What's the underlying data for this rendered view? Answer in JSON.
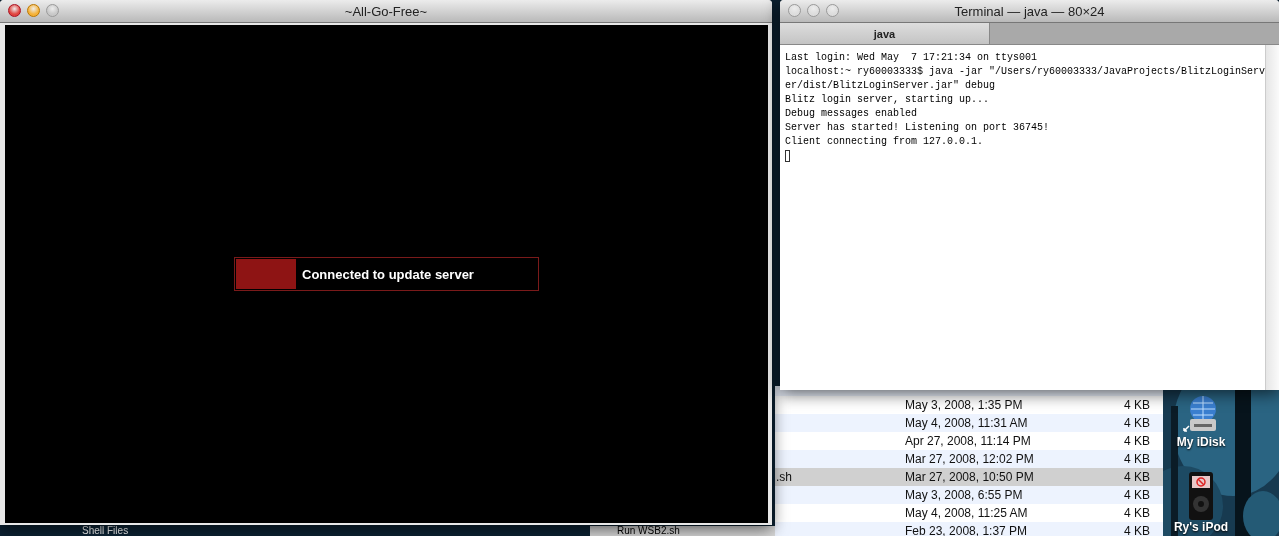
{
  "game_window": {
    "title": "~All-Go-Free~",
    "status": {
      "text": "Connected to update server",
      "level": 0.2
    }
  },
  "terminal": {
    "title": "Terminal — java — 80×24",
    "tabs": [
      {
        "label": "java",
        "selected": true
      }
    ],
    "lines": [
      "Last login: Wed May  7 17:21:34 on ttys001",
      "localhost:~ ry60003333$ java -jar \"/Users/ry60003333/JavaProjects/BlitzLoginServ",
      "er/dist/BlitzLoginServer.jar\" debug",
      "Blitz login server, starting up...",
      "Debug messages enabled",
      "Server has started! Listening on port 36745!",
      "Client connecting from 127.0.0.1."
    ],
    "cursor": true
  },
  "finder": {
    "rows": [
      {
        "date": "May 3, 2008, 1:35 PM",
        "size": "4 KB",
        "selected": false
      },
      {
        "date": "May 4, 2008, 11:31 AM",
        "size": "4 KB",
        "selected": false
      },
      {
        "date": "Apr 27, 2008, 11:14 PM",
        "size": "4 KB",
        "selected": false
      },
      {
        "date": "Mar 27, 2008, 12:02 PM",
        "size": "4 KB",
        "selected": false
      },
      {
        "name": ".sh",
        "date": "Mar 27, 2008, 10:50 PM",
        "size": "4 KB",
        "selected": true
      },
      {
        "date": "May 3, 2008, 6:55 PM",
        "size": "4 KB",
        "selected": false
      },
      {
        "date": "May 4, 2008, 11:25 AM",
        "size": "4 KB",
        "selected": false
      },
      {
        "date": "Feb 23, 2008, 1:37 PM",
        "size": "4 KB",
        "selected": false
      }
    ]
  },
  "desktop_icons": [
    {
      "label": "My iDisk",
      "kind": "network-disk"
    },
    {
      "label": "Ry's iPod",
      "kind": "ipod"
    }
  ],
  "background_items": [
    {
      "label": "Shell Files"
    },
    {
      "label": "Run WSB2.sh"
    }
  ]
}
